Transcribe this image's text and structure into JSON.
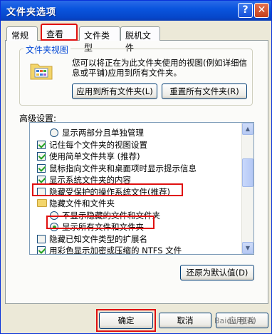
{
  "window": {
    "title": "文件夹选项"
  },
  "titlebar": {
    "help_label": "?",
    "close_label": "✕"
  },
  "tabs": [
    {
      "label": "常规"
    },
    {
      "label": "查看"
    },
    {
      "label": "文件类型"
    },
    {
      "label": "脱机文件"
    }
  ],
  "folder_views": {
    "label": "文件夹视图",
    "description": "您可以将正在为此文件夹使用的视图(例如详细信息或平铺)应用到所有文件夹。",
    "apply_all_label": "应用到所有文件夹(L)",
    "reset_all_label": "重置所有文件夹(R)"
  },
  "advanced": {
    "label": "高级设置:",
    "items": [
      {
        "text": "显示两部分且单独管理",
        "control": "radio",
        "checked": false,
        "indent": 2
      },
      {
        "text": "记住每个文件夹的视图设置",
        "control": "checkbox",
        "checked": true,
        "indent": 1
      },
      {
        "text": "使用简单文件共享 (推荐)",
        "control": "checkbox",
        "checked": true,
        "indent": 1
      },
      {
        "text": "鼠标指向文件夹和桌面项时显示提示信息",
        "control": "checkbox",
        "checked": true,
        "indent": 1
      },
      {
        "text": "显示系统文件夹的内容",
        "control": "checkbox",
        "checked": true,
        "indent": 1
      },
      {
        "text": "隐藏受保护的操作系统文件(推荐)",
        "control": "checkbox",
        "checked": false,
        "indent": 1
      },
      {
        "text": "隐藏文件和文件夹",
        "control": "folder",
        "checked": false,
        "indent": 1
      },
      {
        "text": "不显示隐藏的文件和文件夹",
        "control": "radio",
        "checked": false,
        "indent": 2
      },
      {
        "text": "显示所有文件和文件夹",
        "control": "radio",
        "checked": true,
        "indent": 2
      },
      {
        "text": "隐藏已知文件类型的扩展名",
        "control": "checkbox",
        "checked": false,
        "indent": 1
      },
      {
        "text": "用彩色显示加密或压缩的 NTFS 文件",
        "control": "checkbox",
        "checked": true,
        "indent": 1
      }
    ],
    "restore_label": "还原为默认值(D)"
  },
  "footer": {
    "ok_label": "确定",
    "cancel_label": "取消",
    "apply_label": "应用(A)"
  },
  "watermark": "Baidu 经验",
  "colors": {
    "highlight": "#e01010",
    "title_bar": "#0a55de",
    "check": "#21a121"
  }
}
